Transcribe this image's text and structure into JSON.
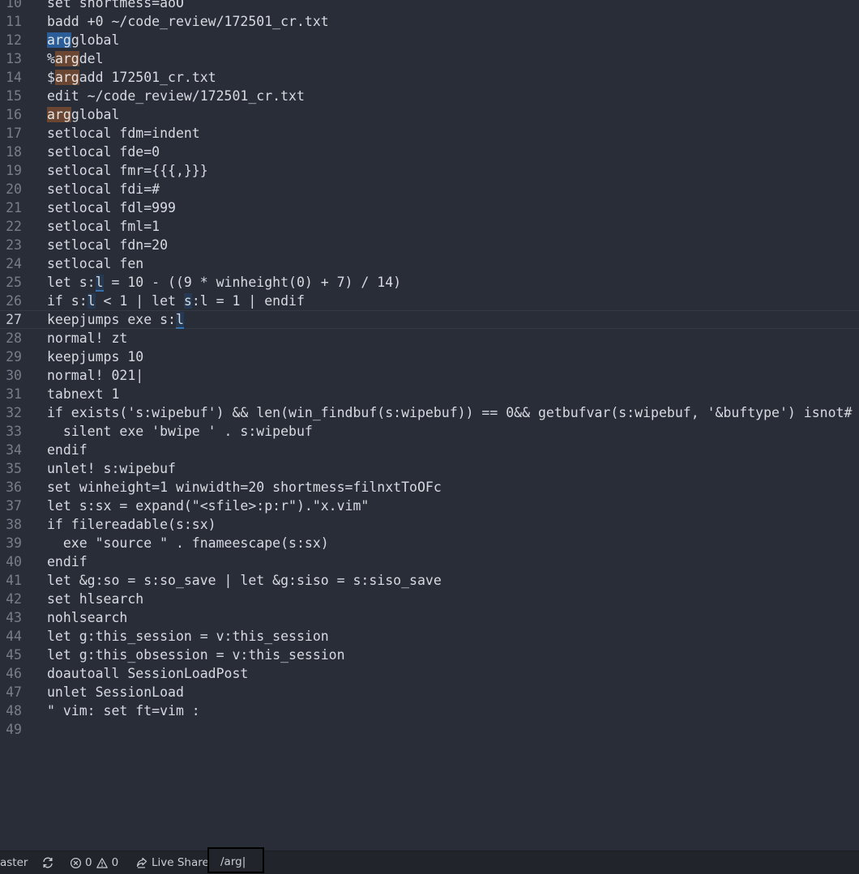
{
  "editor": {
    "lines": [
      {
        "n": "10",
        "t": "set shortmess=aoO"
      },
      {
        "n": "11",
        "t": "badd +0 ~/code_review/172501_cr.txt"
      },
      {
        "n": "12",
        "t": "argglobal"
      },
      {
        "n": "13",
        "t": "%argdel"
      },
      {
        "n": "14",
        "t": "$argadd 172501_cr.txt"
      },
      {
        "n": "15",
        "t": "edit ~/code_review/172501_cr.txt"
      },
      {
        "n": "16",
        "t": "argglobal"
      },
      {
        "n": "17",
        "t": "setlocal fdm=indent"
      },
      {
        "n": "18",
        "t": "setlocal fde=0"
      },
      {
        "n": "19",
        "t": "setlocal fmr={{{,}}}"
      },
      {
        "n": "20",
        "t": "setlocal fdi=#"
      },
      {
        "n": "21",
        "t": "setlocal fdl=999"
      },
      {
        "n": "22",
        "t": "setlocal fml=1"
      },
      {
        "n": "23",
        "t": "setlocal fdn=20"
      },
      {
        "n": "24",
        "t": "setlocal fen"
      },
      {
        "n": "25",
        "t": "let s:l = 10 - ((9 * winheight(0) + 7) / 14)"
      },
      {
        "n": "26",
        "t": "if s:l < 1 | let s:l = 1 | endif"
      },
      {
        "n": "27",
        "t": "keepjumps exe s:l"
      },
      {
        "n": "28",
        "t": "normal! zt"
      },
      {
        "n": "29",
        "t": "keepjumps 10"
      },
      {
        "n": "30",
        "t": "normal! 021|"
      },
      {
        "n": "31",
        "t": "tabnext 1"
      },
      {
        "n": "32",
        "t": "if exists('s:wipebuf') && len(win_findbuf(s:wipebuf)) == 0&& getbufvar(s:wipebuf, '&buftype') isnot# 'terminal'"
      },
      {
        "n": "33",
        "t": "  silent exe 'bwipe ' . s:wipebuf"
      },
      {
        "n": "34",
        "t": "endif"
      },
      {
        "n": "35",
        "t": "unlet! s:wipebuf"
      },
      {
        "n": "36",
        "t": "set winheight=1 winwidth=20 shortmess=filnxtToOFc"
      },
      {
        "n": "37",
        "t": "let s:sx = expand(\"<sfile>:p:r\").\"x.vim\""
      },
      {
        "n": "38",
        "t": "if filereadable(s:sx)"
      },
      {
        "n": "39",
        "t": "  exe \"source \" . fnameescape(s:sx)"
      },
      {
        "n": "40",
        "t": "endif"
      },
      {
        "n": "41",
        "t": "let &g:so = s:so_save | let &g:siso = s:siso_save"
      },
      {
        "n": "42",
        "t": "set hlsearch"
      },
      {
        "n": "43",
        "t": "nohlsearch"
      },
      {
        "n": "44",
        "t": "let g:this_session = v:this_session"
      },
      {
        "n": "45",
        "t": "let g:this_obsession = v:this_session"
      },
      {
        "n": "46",
        "t": "doautoall SessionLoadPost"
      },
      {
        "n": "47",
        "t": "unlet SessionLoad"
      },
      {
        "n": "48",
        "t": "\" vim: set ft=vim :"
      },
      {
        "n": "49",
        "t": ""
      }
    ]
  },
  "statusbar": {
    "branch": "aster",
    "errors": "0",
    "warnings": "0",
    "live_share": "Live Share",
    "command_line": "/arg|"
  },
  "icons": {
    "sync": "sync-icon",
    "error": "error-icon",
    "warning": "warning-icon",
    "live_share": "live-share-icon"
  },
  "colors": {
    "background": "#292d37",
    "current_match": "#2b5d98",
    "other_match": "#6b4632",
    "status_bar": "#21252b"
  }
}
